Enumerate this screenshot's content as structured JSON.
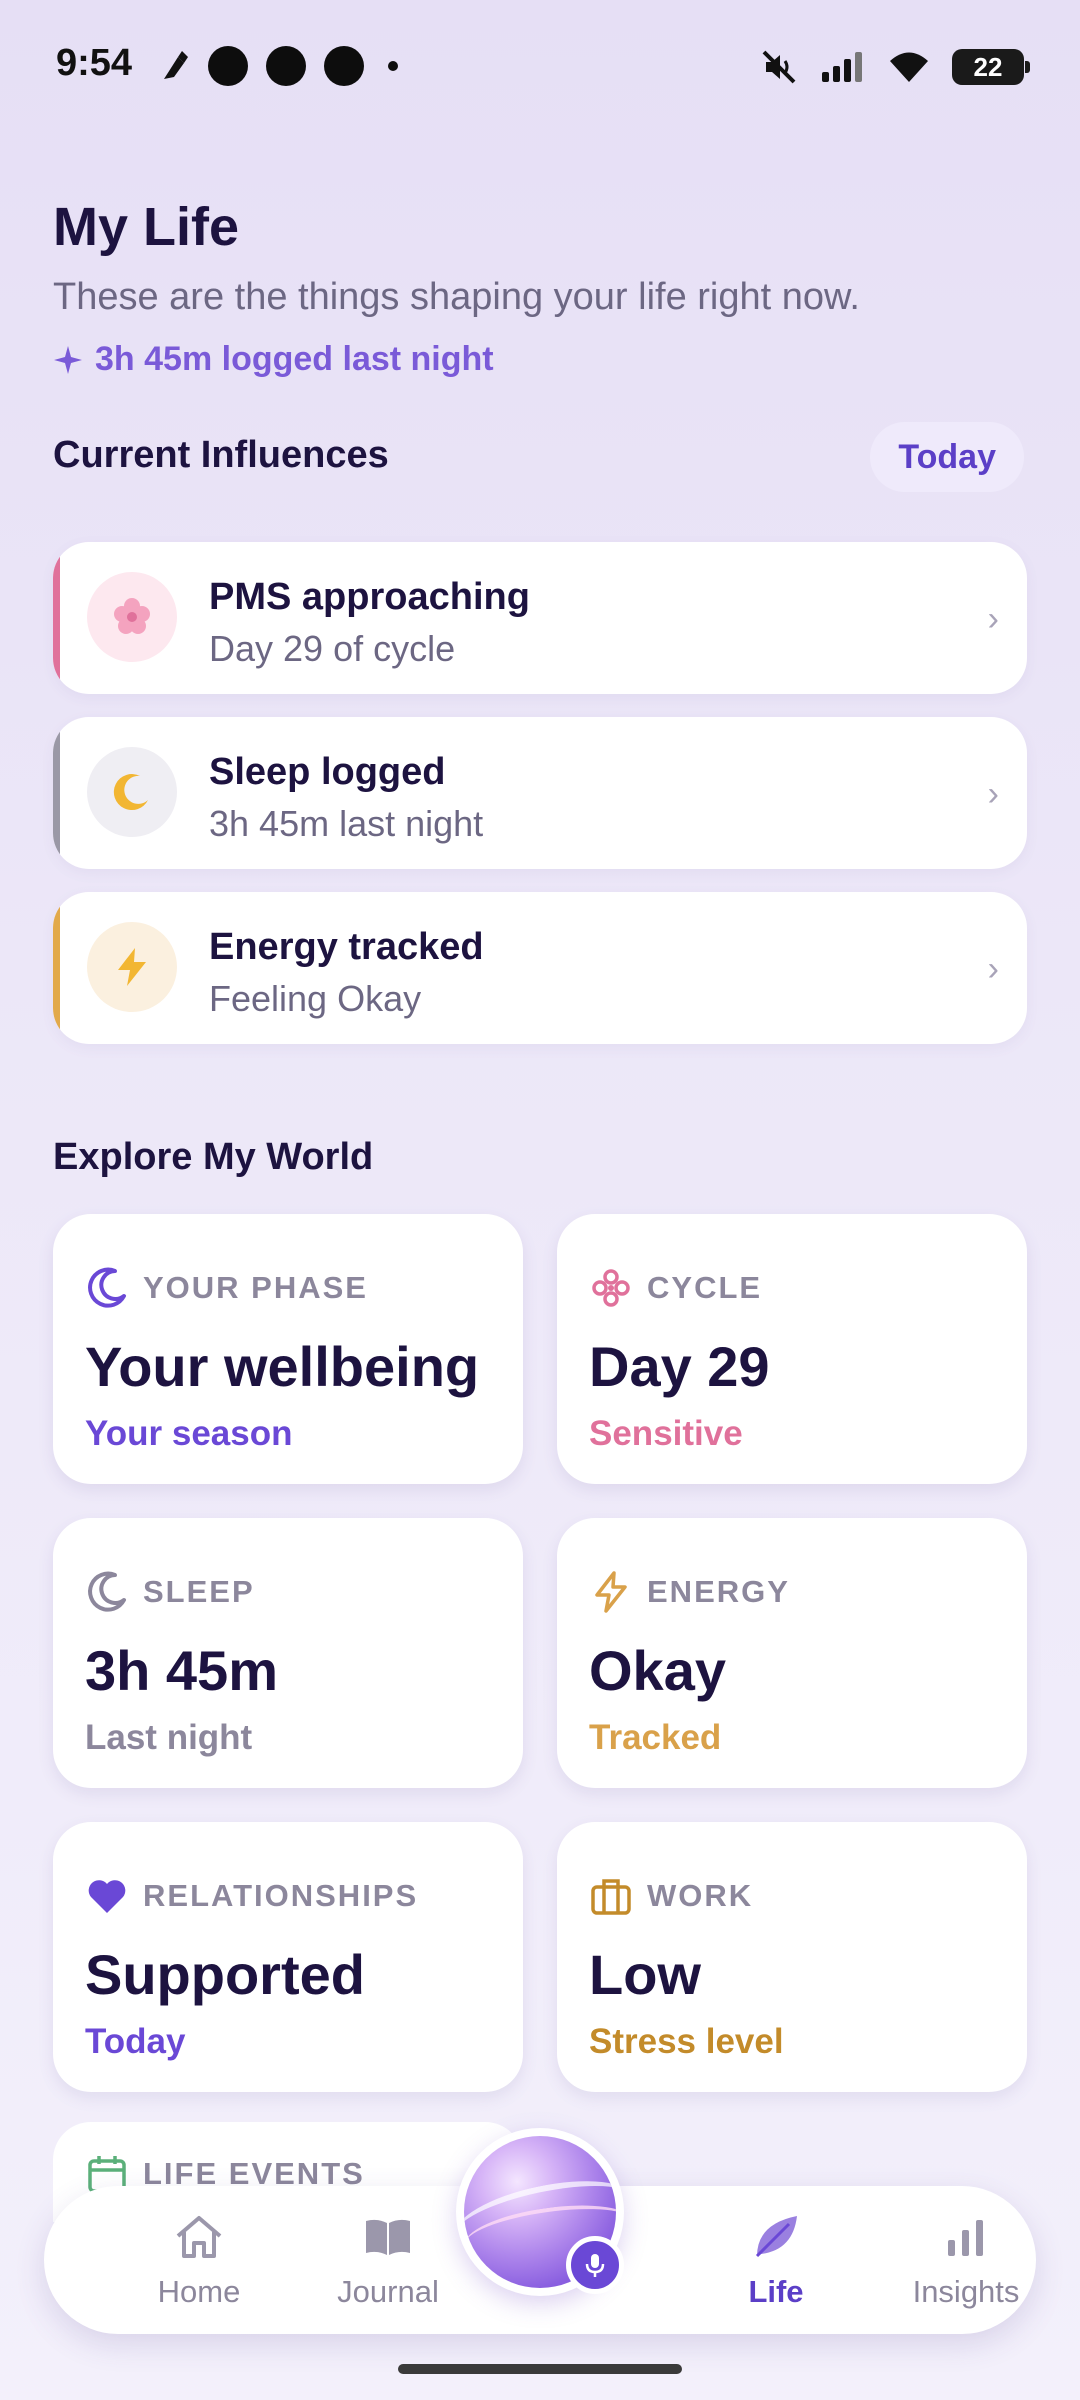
{
  "status_bar": {
    "time": "9:54",
    "battery": "22"
  },
  "header": {
    "title": "My Life",
    "subtitle": "These are the things shaping your life right now.",
    "logged": "3h 45m logged last night"
  },
  "influences": {
    "title": "Current Influences",
    "filter": "Today",
    "items": [
      {
        "title": "PMS approaching",
        "subtitle": "Day 29 of cycle",
        "icon": "flower-icon",
        "accent": "#e0719b"
      },
      {
        "title": "Sleep logged",
        "subtitle": "3h 45m last night",
        "icon": "moon-icon",
        "accent": "#9a98a6"
      },
      {
        "title": "Energy tracked",
        "subtitle": "Feeling Okay",
        "icon": "lightning-icon",
        "accent": "#e2a94a"
      }
    ]
  },
  "explore": {
    "title": "Explore My World",
    "tiles": [
      {
        "label": "YOUR PHASE",
        "value": "Your wellbeing",
        "sub": "Your season",
        "icon": "moon-icon",
        "color": "#6a48d6"
      },
      {
        "label": "CYCLE",
        "value": "Day 29",
        "sub": "Sensitive",
        "icon": "flower-icon",
        "color": "#e0719b"
      },
      {
        "label": "SLEEP",
        "value": "3h 45m",
        "sub": "Last night",
        "icon": "moon-icon",
        "color": "#8c879c"
      },
      {
        "label": "ENERGY",
        "value": "Okay",
        "sub": "Tracked",
        "icon": "lightning-icon",
        "color": "#d9a14a"
      },
      {
        "label": "RELATIONSHIPS",
        "value": "Supported",
        "sub": "Today",
        "icon": "heart-icon",
        "color": "#6a48d6"
      },
      {
        "label": "WORK",
        "value": "Low",
        "sub": "Stress level",
        "icon": "briefcase-icon",
        "color": "#c38b2a"
      },
      {
        "label": "LIFE EVENTS",
        "icon": "calendar-icon",
        "color": "#5bb07a"
      }
    ]
  },
  "nav": {
    "items": [
      {
        "label": "Home",
        "icon": "home-icon"
      },
      {
        "label": "Journal",
        "icon": "book-icon"
      },
      {
        "label": "Life",
        "icon": "leaf-icon",
        "active": true
      },
      {
        "label": "Insights",
        "icon": "bar-chart-icon"
      }
    ],
    "center": "voice-orb-button"
  }
}
